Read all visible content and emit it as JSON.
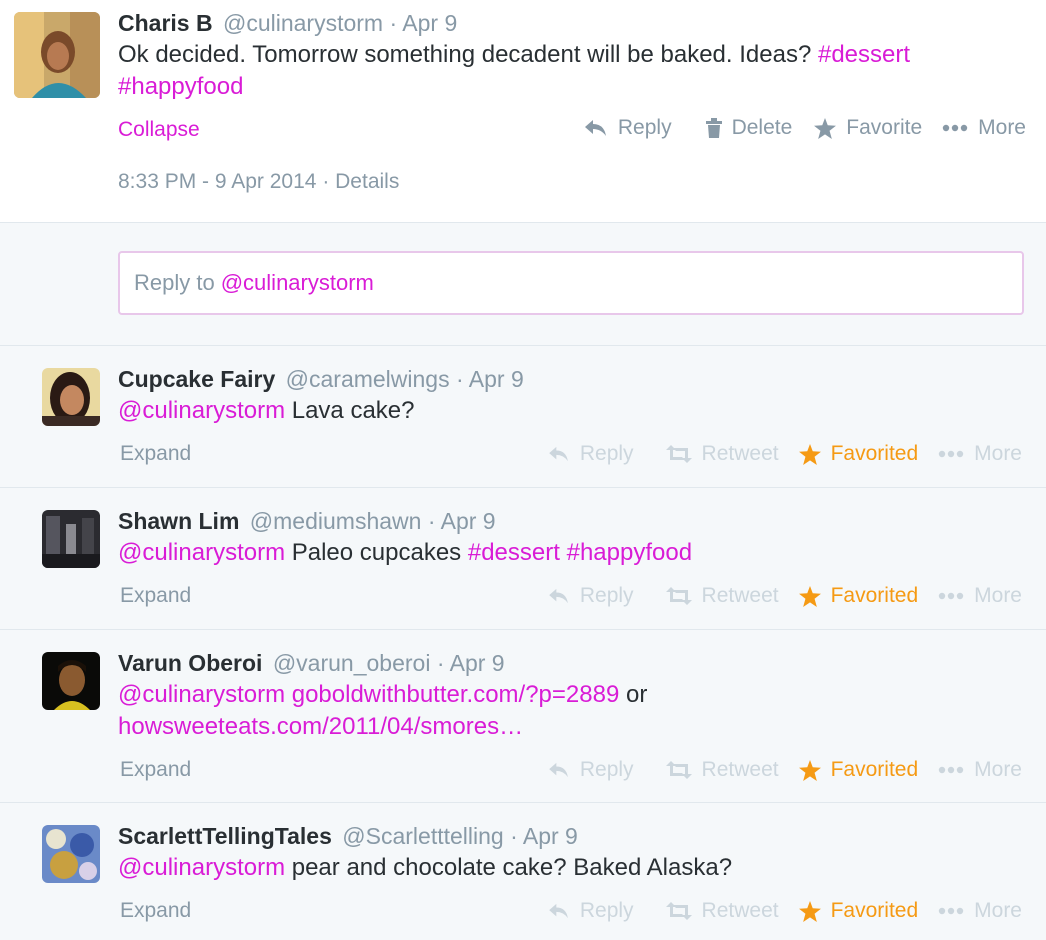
{
  "main_tweet": {
    "name": "Charis B",
    "handle": "@culinarystorm",
    "date": "Apr 9",
    "text_plain": "Ok decided. Tomorrow something decadent will be baked. Ideas?",
    "hashtag1": "#dessert",
    "hashtag2": "#happyfood",
    "collapse_label": "Collapse",
    "actions": {
      "reply": "Reply",
      "delete": "Delete",
      "favorite": "Favorite",
      "more": "More"
    },
    "timestamp": "8:33 PM - 9 Apr 2014",
    "details": "Details"
  },
  "reply_box": {
    "prefix": "Reply to",
    "mention": "@culinarystorm"
  },
  "replies": [
    {
      "name": "Cupcake Fairy",
      "handle": "@caramelwings",
      "date": "Apr 9",
      "mention": "@culinarystorm",
      "text": "Lava cake?",
      "expand": "Expand",
      "actions": {
        "reply": "Reply",
        "retweet": "Retweet",
        "favorited": "Favorited",
        "more": "More"
      }
    },
    {
      "name": "Shawn Lim",
      "handle": "@mediumshawn",
      "date": "Apr 9",
      "mention": "@culinarystorm",
      "text": "Paleo cupcakes",
      "hashtag1": "#dessert",
      "hashtag2": "#happyfood",
      "expand": "Expand",
      "actions": {
        "reply": "Reply",
        "retweet": "Retweet",
        "favorited": "Favorited",
        "more": "More"
      }
    },
    {
      "name": "Varun Oberoi",
      "handle": "@varun_oberoi",
      "date": "Apr 9",
      "mention": "@culinarystorm",
      "link1": "goboldwithbutter.com/?p=2889",
      "or": "or",
      "link2": "howsweeteats.com/2011/04/smores…",
      "expand": "Expand",
      "actions": {
        "reply": "Reply",
        "retweet": "Retweet",
        "favorited": "Favorited",
        "more": "More"
      }
    },
    {
      "name": "ScarlettTellingTales",
      "handle": "@Scarletttelling",
      "date": "Apr 9",
      "mention": "@culinarystorm",
      "text": "pear and chocolate cake? Baked Alaska?",
      "expand": "Expand",
      "actions": {
        "reply": "Reply",
        "retweet": "Retweet",
        "favorited": "Favorited",
        "more": "More"
      }
    }
  ],
  "colors": {
    "accent": "#d91cd6",
    "muted": "#8899a6",
    "favorited": "#f59a14",
    "faded": "#ccd6dd"
  }
}
